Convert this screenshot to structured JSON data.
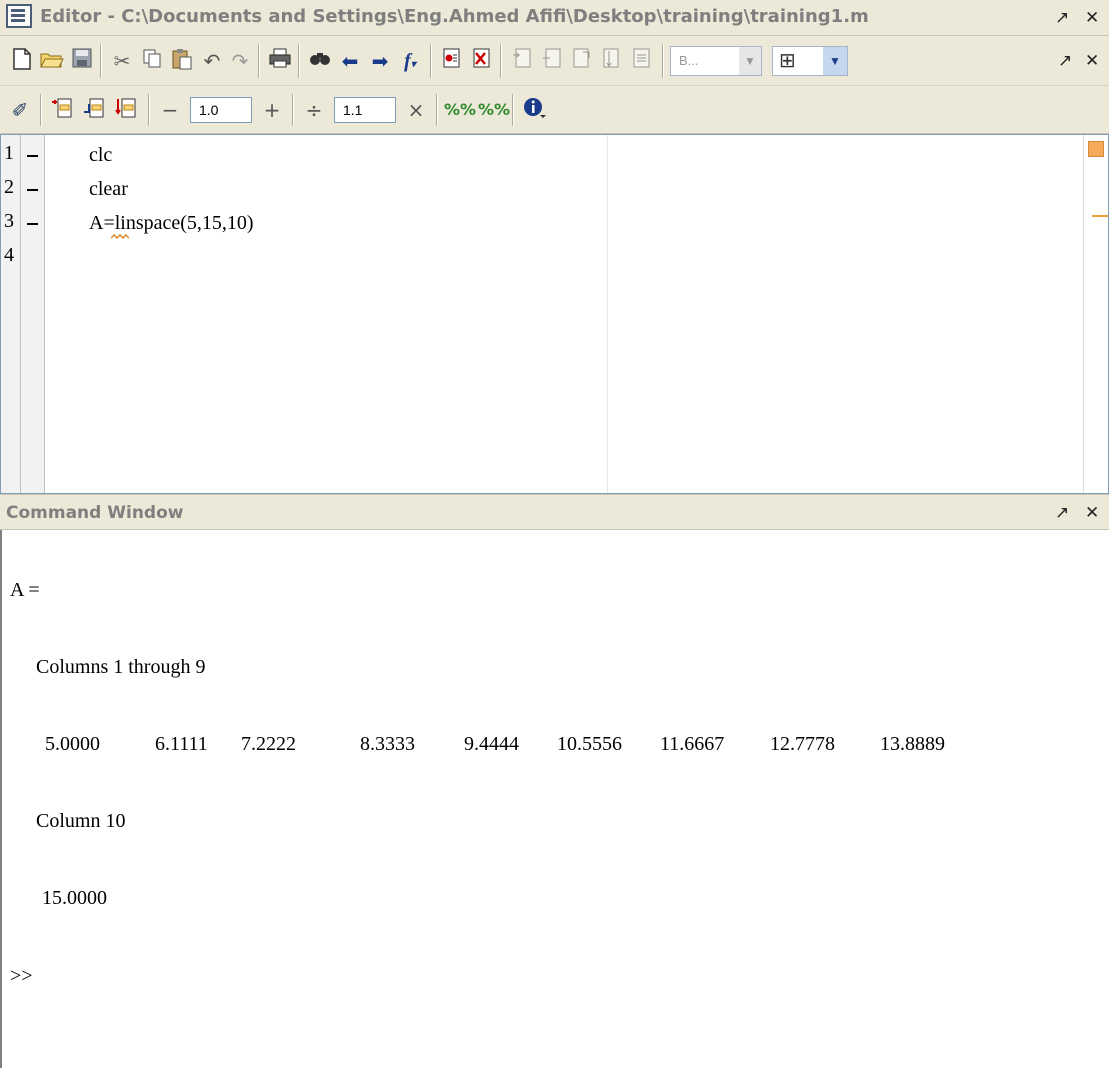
{
  "editor": {
    "title": "Editor - C:\\Documents and Settings\\Eng.Ahmed Afifi\\Desktop\\training\\training1.m",
    "undock_label": "↗",
    "close_label": "✕",
    "lines": [
      {
        "number": "1",
        "code": "clc",
        "breakpoint_dash": true
      },
      {
        "number": "2",
        "code": "clear",
        "breakpoint_dash": true
      },
      {
        "number": "3",
        "code": "A=linspace(5,15,10)",
        "breakpoint_dash": true
      },
      {
        "number": "4",
        "code": "",
        "breakpoint_dash": false
      }
    ]
  },
  "toolbar1": {
    "icons": [
      "new-file-icon",
      "open-folder-icon",
      "save-icon",
      "cut-icon",
      "copy-icon",
      "paste-icon",
      "undo-icon",
      "redo-icon",
      "print-icon",
      "find-icon",
      "back-icon",
      "forward-icon",
      "function-icon",
      "set-breakpoint-icon",
      "clear-breakpoint-icon",
      "step-icon",
      "step-in-icon",
      "step-out-icon",
      "continue-icon",
      "exit-debug-icon",
      "stack-dropdown",
      "layout-grid-icon"
    ],
    "stack_value": "B...",
    "undock_label": "↗",
    "close_label": "✕"
  },
  "toolbar2": {
    "decrement_label": "−",
    "increment_label": "+",
    "divide_label": "÷",
    "multiply_label": "×",
    "value1": "1.0",
    "value2": "1.1"
  },
  "command_window": {
    "title": "Command Window",
    "undock_label": "↗",
    "close_label": "✕",
    "var_line": "A =",
    "columns_header_1": "Columns 1 through 9",
    "values_1": [
      "5.0000",
      "6.1111",
      "7.2222",
      "8.3333",
      "9.4444",
      "10.5556",
      "11.6667",
      "12.7778",
      "13.8889"
    ],
    "columns_header_2": "Column 10",
    "values_2": [
      "15.0000"
    ],
    "prompt": ">>"
  },
  "colors": {
    "chrome": "#ece9d8",
    "title_text": "#7f7f7f",
    "editor_border": "#7f9db9",
    "warning_marker": "#f5a95a"
  }
}
